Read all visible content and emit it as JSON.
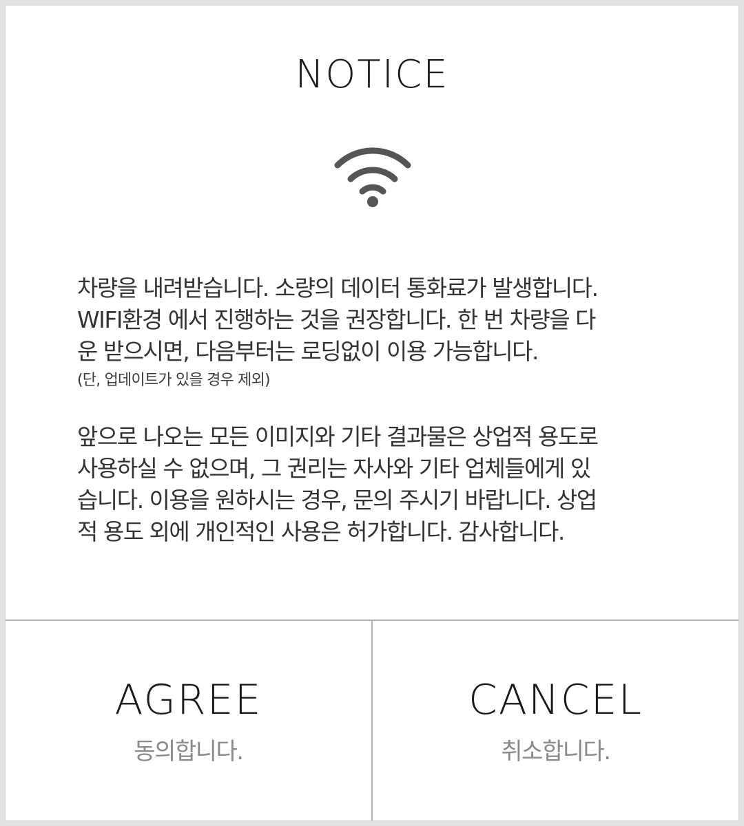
{
  "dialog": {
    "title": "NOTICE",
    "icon": "wifi-icon",
    "icon_color": "#555555",
    "paragraph1": {
      "lines": [
        "차량을 내려받습니다. 소량의 데이터 통화료가 발생합니다.",
        "WIFI환경 에서 진행하는 것을 권장합니다. 한 번 차량을 다",
        "운 받으시면, 다음부터는 로딩없이 이용 가능합니다."
      ],
      "note": "(단, 업데이트가 있을 경우 제외)"
    },
    "paragraph2": {
      "lines": [
        "앞으로 나오는 모든 이미지와 기타 결과물은 상업적 용도로",
        "사용하실 수 없으며, 그 권리는 자사와 기타 업체들에게 있",
        "습니다. 이용을 원하시는 경우, 문의 주시기 바랍니다. 상업",
        "적 용도 외에 개인적인 사용은 허가합니다. 감사합니다."
      ]
    }
  },
  "buttons": {
    "agree": {
      "label": "AGREE",
      "sublabel": "동의합니다."
    },
    "cancel": {
      "label": "CANCEL",
      "sublabel": "취소합니다."
    }
  }
}
